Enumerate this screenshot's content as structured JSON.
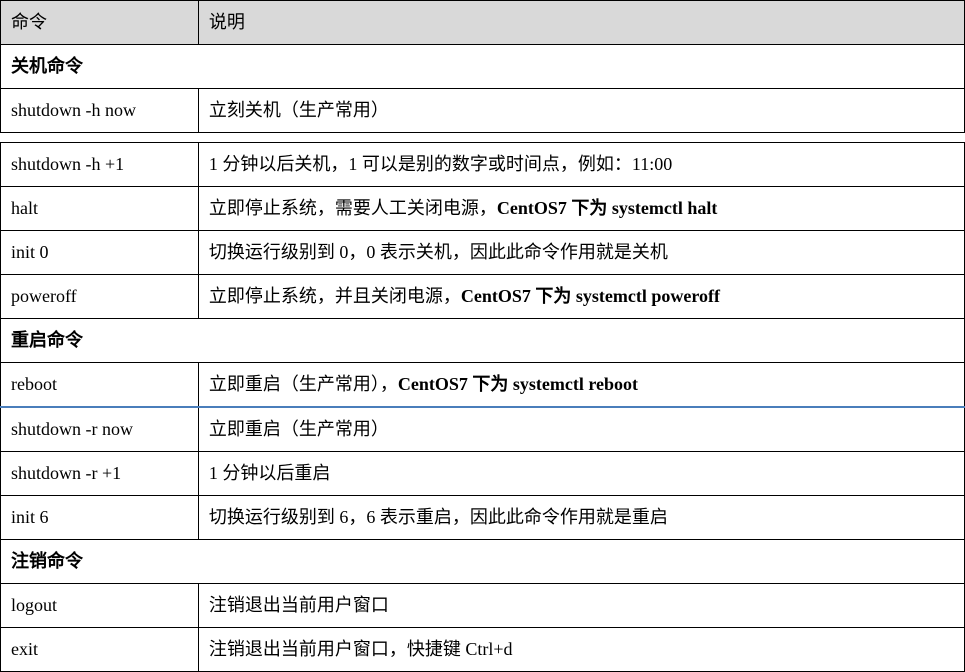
{
  "header": {
    "col1": "命令",
    "col2": "说明"
  },
  "sections": [
    {
      "title": "关机命令",
      "rows": [
        {
          "cmd": "shutdown -h now",
          "desc_parts": [
            {
              "t": "立刻关机（生产常用）"
            }
          ]
        }
      ]
    },
    {
      "gap": true,
      "rows": [
        {
          "cmd": "shutdown -h +1",
          "desc_parts": [
            {
              "t": "1 分钟以后关机，1 可以是别的数字或时间点，例如：11:00"
            }
          ]
        },
        {
          "cmd": "halt",
          "desc_parts": [
            {
              "t": "立即停止系统，需要人工关闭电源，"
            },
            {
              "t": "CentOS7 下为 systemctl halt",
              "b": true
            }
          ]
        },
        {
          "cmd": "init 0",
          "desc_parts": [
            {
              "t": "切换运行级别到 0，0 表示关机，因此此命令作用就是关机"
            }
          ]
        },
        {
          "cmd": "poweroff",
          "desc_parts": [
            {
              "t": "立即停止系统，并且关闭电源，"
            },
            {
              "t": "CentOS7 下为 systemctl poweroff",
              "b": true
            }
          ]
        }
      ]
    },
    {
      "title": "重启命令",
      "rows": [
        {
          "cmd": "reboot",
          "highlight": true,
          "desc_parts": [
            {
              "t": "立即重启（生产常用），"
            },
            {
              "t": "CentOS7 下为 systemctl reboot",
              "b": true
            }
          ]
        },
        {
          "cmd": "shutdown -r now",
          "desc_parts": [
            {
              "t": "立即重启（生产常用）"
            }
          ]
        },
        {
          "cmd": "shutdown -r +1",
          "desc_parts": [
            {
              "t": "1 分钟以后重启"
            }
          ]
        },
        {
          "cmd": "init 6",
          "desc_parts": [
            {
              "t": "切换运行级别到 6，6 表示重启，因此此命令作用就是重启"
            }
          ]
        }
      ]
    },
    {
      "title": "注销命令",
      "rows": [
        {
          "cmd": "logout",
          "desc_parts": [
            {
              "t": "注销退出当前用户窗口"
            }
          ]
        },
        {
          "cmd": "exit",
          "desc_parts": [
            {
              "t": "注销退出当前用户窗口，快捷键 Ctrl+d"
            }
          ]
        }
      ]
    }
  ]
}
